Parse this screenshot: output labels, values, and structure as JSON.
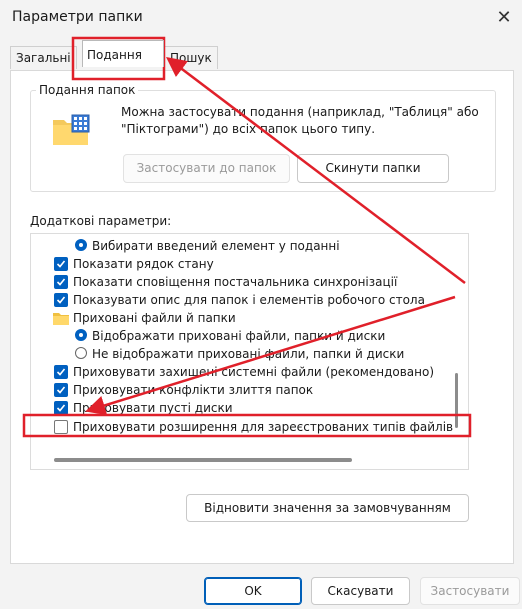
{
  "window": {
    "title": "Параметри папки",
    "close_glyph": "✕"
  },
  "tabs": [
    "Загальні",
    "Подання",
    "Пошук"
  ],
  "folder_views": {
    "group_label": "Подання папок",
    "description": "Можна застосувати подання (наприклад, \"Таблиця\" або \"Піктограми\") до всіх папок цього типу.",
    "apply_button": "Застосувати до папок",
    "reset_button": "Скинути папки"
  },
  "advanced": {
    "label": "Додаткові параметри:",
    "items": [
      {
        "type": "radio",
        "checked": true,
        "indent": 1,
        "label": "Вибирати введений елемент у поданні"
      },
      {
        "type": "checkbox",
        "checked": true,
        "indent": 0,
        "label": "Показати рядок стану"
      },
      {
        "type": "checkbox",
        "checked": true,
        "indent": 0,
        "label": "Показати сповіщення постачальника синхронізації"
      },
      {
        "type": "checkbox",
        "checked": true,
        "indent": 0,
        "label": "Показувати опис для папок і елементів робочого стола"
      },
      {
        "type": "folder",
        "indent": 0,
        "label": "Приховані файли й папки"
      },
      {
        "type": "radio",
        "checked": true,
        "indent": 1,
        "label": "Відображати приховані файли, папки й диски"
      },
      {
        "type": "radio",
        "checked": false,
        "indent": 1,
        "label": "Не відображати приховані файли, папки й диски"
      },
      {
        "type": "checkbox",
        "checked": true,
        "indent": 0,
        "label": "Приховувати захищені системні файли (рекомендовано)"
      },
      {
        "type": "checkbox",
        "checked": true,
        "indent": 0,
        "label": "Приховувати конфлікти злиття папок"
      },
      {
        "type": "checkbox",
        "checked": true,
        "indent": 0,
        "label": "Приховувати пусті диски"
      },
      {
        "type": "checkbox",
        "checked": false,
        "indent": 0,
        "label": "Приховувати розширення для зареєстрованих типів файлів"
      }
    ]
  },
  "restore_button": "Відновити значення за замовчуванням",
  "footer": {
    "ok": "OK",
    "cancel": "Скасувати",
    "apply": "Застосувати"
  },
  "colors": {
    "accent": "#0060c0",
    "annotation": "#e0202a"
  }
}
